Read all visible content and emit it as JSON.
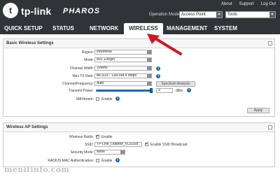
{
  "header": {
    "brand": "tp-link",
    "product": "PHAROS",
    "links": [
      "About",
      "Support",
      "Log Out"
    ],
    "operation_mode_label": "Operation Mode:",
    "operation_mode_value": "Access Point",
    "tools_value": "Tools",
    "bg_color": "#2f3437"
  },
  "nav": {
    "items": [
      "QUICK SETUP",
      "STATUS",
      "NETWORK",
      "WIRELESS",
      "MANAGEMENT",
      "SYSTEM"
    ],
    "active": "WIRELESS"
  },
  "basic": {
    "title": "Basic Wireless Settings",
    "region_label": "Region:",
    "region_value": "Indonesia",
    "mode_label": "Mode:",
    "mode_value": "802.11b/g/n",
    "channel_width_label": "Channel Width:",
    "channel_width_value": "20MHz",
    "max_tx_label": "Max TX Rate:",
    "max_tx_value": "MCS15 - 130/144.4 Mbps",
    "channel_label": "Channel/Frequency:",
    "channel_value": "Auto",
    "spectrum_button": "Spectrum Analysis",
    "tx_power_label": "Transmit Power:",
    "tx_power_value": "9",
    "tx_power_unit": "dBm",
    "maxtream_label": "MAXtream:",
    "maxtream_option": "Enable",
    "apply_button": "Apply"
  },
  "ap": {
    "title": "Wireless AP Settings",
    "radio_label": "Wireless Radio:",
    "radio_option": "Enable",
    "ssid_label": "SSID:",
    "ssid_value": "TP-Link_Outdoor_6C52D8",
    "broadcast_option": "Enable SSID Broadcast",
    "security_label": "Security Mode:",
    "security_value": "None",
    "radius_label": "RADIUS MAC Authentication:",
    "radius_option": "Enable"
  },
  "watermark": "menitinfo.com",
  "colors": {
    "accent": "#1c6aa8",
    "arrow": "#d2161e"
  }
}
